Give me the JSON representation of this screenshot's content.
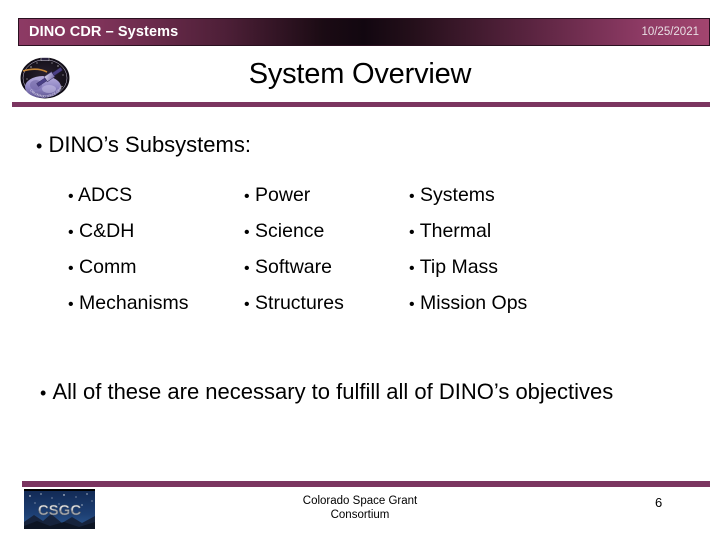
{
  "slide": {
    "header": {
      "title": "DINO CDR – Systems",
      "date": "10/25/2021",
      "accent_color": "#8d3a64",
      "logo_icon": "dino-mission-patch-icon"
    },
    "title": "System Overview",
    "rule_color": "#7b3560",
    "lead_bullet": "DINO’s Subsystems:",
    "bullet_glyph": "•",
    "subsystem_columns": [
      {
        "items": [
          "ADCS",
          "C&DH",
          "Comm",
          "Mechanisms"
        ]
      },
      {
        "items": [
          "Power",
          "Science",
          "Software",
          "Structures"
        ]
      },
      {
        "items": [
          "Systems",
          "Thermal",
          "Tip Mass",
          "Mission Ops"
        ]
      }
    ],
    "closing_bullet": "All of these are necessary to fulfill all of DINO’s objectives",
    "footer": {
      "logo_text": "CSGC",
      "logo_icon": "csgc-starfield-logo-icon",
      "organization_line_1": "Colorado Space Grant",
      "organization_line_2": "Consortium",
      "page_number": "6"
    }
  }
}
